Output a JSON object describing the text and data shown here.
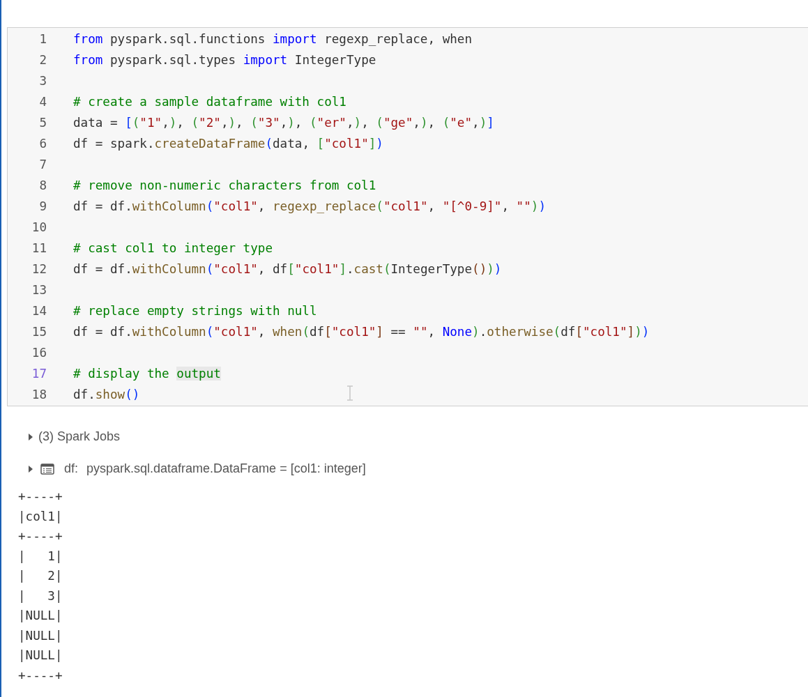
{
  "code_cell": {
    "lines": [
      {
        "number": "1",
        "active": false,
        "tokens": [
          {
            "kind": "keyword",
            "text": "from"
          },
          {
            "kind": "plain",
            "text": " pyspark.sql.functions "
          },
          {
            "kind": "keyword",
            "text": "import"
          },
          {
            "kind": "plain",
            "text": " regexp_replace, when"
          }
        ]
      },
      {
        "number": "2",
        "active": false,
        "tokens": [
          {
            "kind": "keyword",
            "text": "from"
          },
          {
            "kind": "plain",
            "text": " pyspark.sql.types "
          },
          {
            "kind": "keyword",
            "text": "import"
          },
          {
            "kind": "plain",
            "text": " IntegerType"
          }
        ]
      },
      {
        "number": "3",
        "active": false
      },
      {
        "number": "4",
        "active": false,
        "tokens": [
          {
            "kind": "comment",
            "text": "# create a sample dataframe with col1"
          }
        ]
      },
      {
        "number": "5",
        "active": false,
        "tokens": [
          {
            "kind": "plain",
            "text": "data = "
          },
          {
            "kind": "bracket1",
            "text": "["
          },
          {
            "kind": "bracket2",
            "text": "("
          },
          {
            "kind": "string",
            "text": "\"1\""
          },
          {
            "kind": "plain",
            "text": ","
          },
          {
            "kind": "bracket2",
            "text": ")"
          },
          {
            "kind": "plain",
            "text": ", "
          },
          {
            "kind": "bracket2",
            "text": "("
          },
          {
            "kind": "string",
            "text": "\"2\""
          },
          {
            "kind": "plain",
            "text": ","
          },
          {
            "kind": "bracket2",
            "text": ")"
          },
          {
            "kind": "plain",
            "text": ", "
          },
          {
            "kind": "bracket2",
            "text": "("
          },
          {
            "kind": "string",
            "text": "\"3\""
          },
          {
            "kind": "plain",
            "text": ","
          },
          {
            "kind": "bracket2",
            "text": ")"
          },
          {
            "kind": "plain",
            "text": ", "
          },
          {
            "kind": "bracket2",
            "text": "("
          },
          {
            "kind": "string",
            "text": "\"er\""
          },
          {
            "kind": "plain",
            "text": ","
          },
          {
            "kind": "bracket2",
            "text": ")"
          },
          {
            "kind": "plain",
            "text": ", "
          },
          {
            "kind": "bracket2",
            "text": "("
          },
          {
            "kind": "string",
            "text": "\"ge\""
          },
          {
            "kind": "plain",
            "text": ","
          },
          {
            "kind": "bracket2",
            "text": ")"
          },
          {
            "kind": "plain",
            "text": ", "
          },
          {
            "kind": "bracket2",
            "text": "("
          },
          {
            "kind": "string",
            "text": "\"e\""
          },
          {
            "kind": "plain",
            "text": ","
          },
          {
            "kind": "bracket2",
            "text": ")"
          },
          {
            "kind": "bracket1",
            "text": "]"
          }
        ]
      },
      {
        "number": "6",
        "active": false,
        "tokens": [
          {
            "kind": "plain",
            "text": "df = spark."
          },
          {
            "kind": "function",
            "text": "createDataFrame"
          },
          {
            "kind": "bracket1",
            "text": "("
          },
          {
            "kind": "plain",
            "text": "data, "
          },
          {
            "kind": "bracket2",
            "text": "["
          },
          {
            "kind": "string",
            "text": "\"col1\""
          },
          {
            "kind": "bracket2",
            "text": "]"
          },
          {
            "kind": "bracket1",
            "text": ")"
          }
        ]
      },
      {
        "number": "7",
        "active": false
      },
      {
        "number": "8",
        "active": false,
        "tokens": [
          {
            "kind": "comment",
            "text": "# remove non-numeric characters from col1"
          }
        ]
      },
      {
        "number": "9",
        "active": false,
        "tokens": [
          {
            "kind": "plain",
            "text": "df = df."
          },
          {
            "kind": "function",
            "text": "withColumn"
          },
          {
            "kind": "bracket1",
            "text": "("
          },
          {
            "kind": "string",
            "text": "\"col1\""
          },
          {
            "kind": "plain",
            "text": ", "
          },
          {
            "kind": "function",
            "text": "regexp_replace"
          },
          {
            "kind": "bracket2",
            "text": "("
          },
          {
            "kind": "string",
            "text": "\"col1\""
          },
          {
            "kind": "plain",
            "text": ", "
          },
          {
            "kind": "string",
            "text": "\"[^0-9]\""
          },
          {
            "kind": "plain",
            "text": ", "
          },
          {
            "kind": "string",
            "text": "\"\""
          },
          {
            "kind": "bracket2",
            "text": ")"
          },
          {
            "kind": "bracket1",
            "text": ")"
          }
        ]
      },
      {
        "number": "10",
        "active": false
      },
      {
        "number": "11",
        "active": false,
        "tokens": [
          {
            "kind": "comment",
            "text": "# cast col1 to integer type"
          }
        ]
      },
      {
        "number": "12",
        "active": false,
        "tokens": [
          {
            "kind": "plain",
            "text": "df = df."
          },
          {
            "kind": "function",
            "text": "withColumn"
          },
          {
            "kind": "bracket1",
            "text": "("
          },
          {
            "kind": "string",
            "text": "\"col1\""
          },
          {
            "kind": "plain",
            "text": ", df"
          },
          {
            "kind": "bracket2",
            "text": "["
          },
          {
            "kind": "string",
            "text": "\"col1\""
          },
          {
            "kind": "bracket2",
            "text": "]"
          },
          {
            "kind": "plain",
            "text": "."
          },
          {
            "kind": "function",
            "text": "cast"
          },
          {
            "kind": "bracket2",
            "text": "("
          },
          {
            "kind": "plain",
            "text": "IntegerType"
          },
          {
            "kind": "bracket3",
            "text": "()"
          },
          {
            "kind": "bracket2",
            "text": ")"
          },
          {
            "kind": "bracket1",
            "text": ")"
          }
        ]
      },
      {
        "number": "13",
        "active": false
      },
      {
        "number": "14",
        "active": false,
        "tokens": [
          {
            "kind": "comment",
            "text": "# replace empty strings with null"
          }
        ]
      },
      {
        "number": "15",
        "active": false,
        "tokens": [
          {
            "kind": "plain",
            "text": "df = df."
          },
          {
            "kind": "function",
            "text": "withColumn"
          },
          {
            "kind": "bracket1",
            "text": "("
          },
          {
            "kind": "string",
            "text": "\"col1\""
          },
          {
            "kind": "plain",
            "text": ", "
          },
          {
            "kind": "function",
            "text": "when"
          },
          {
            "kind": "bracket2",
            "text": "("
          },
          {
            "kind": "plain",
            "text": "df"
          },
          {
            "kind": "bracket3",
            "text": "["
          },
          {
            "kind": "string",
            "text": "\"col1\""
          },
          {
            "kind": "bracket3",
            "text": "]"
          },
          {
            "kind": "plain",
            "text": " == "
          },
          {
            "kind": "string",
            "text": "\"\""
          },
          {
            "kind": "plain",
            "text": ", "
          },
          {
            "kind": "keyword",
            "text": "None"
          },
          {
            "kind": "bracket2",
            "text": ")"
          },
          {
            "kind": "plain",
            "text": "."
          },
          {
            "kind": "function",
            "text": "otherwise"
          },
          {
            "kind": "bracket2",
            "text": "("
          },
          {
            "kind": "plain",
            "text": "df"
          },
          {
            "kind": "bracket3",
            "text": "["
          },
          {
            "kind": "string",
            "text": "\"col1\""
          },
          {
            "kind": "bracket3",
            "text": "]"
          },
          {
            "kind": "bracket2",
            "text": ")"
          },
          {
            "kind": "bracket1",
            "text": ")"
          }
        ]
      },
      {
        "number": "16",
        "active": false
      },
      {
        "number": "17",
        "active": true,
        "tokens": [
          {
            "kind": "comment",
            "text": "# display the "
          },
          {
            "kind": "comment-highlight",
            "text": "output"
          }
        ]
      },
      {
        "number": "18",
        "active": false,
        "tokens": [
          {
            "kind": "plain",
            "text": "df."
          },
          {
            "kind": "function",
            "text": "show"
          },
          {
            "kind": "bracket1",
            "text": "()"
          }
        ]
      }
    ]
  },
  "output": {
    "spark_jobs": {
      "label": "(3) Spark Jobs",
      "expanded": false
    },
    "variable": {
      "name": "df:",
      "type": "pyspark.sql.dataframe.DataFrame = [col1: integer]",
      "expanded": false
    },
    "table_text": [
      "+----+",
      "|col1|",
      "+----+",
      "|   1|",
      "|   2|",
      "|   3|",
      "|NULL|",
      "|NULL|",
      "|NULL|",
      "+----+"
    ]
  }
}
